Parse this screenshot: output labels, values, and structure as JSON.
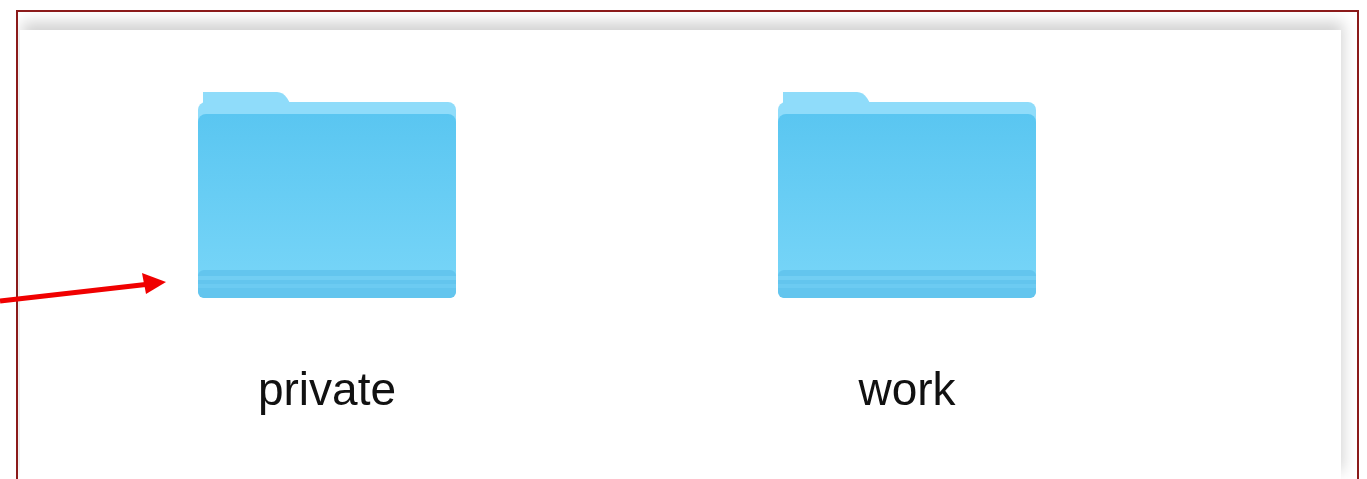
{
  "folders": [
    {
      "name": "private"
    },
    {
      "name": "work"
    }
  ]
}
